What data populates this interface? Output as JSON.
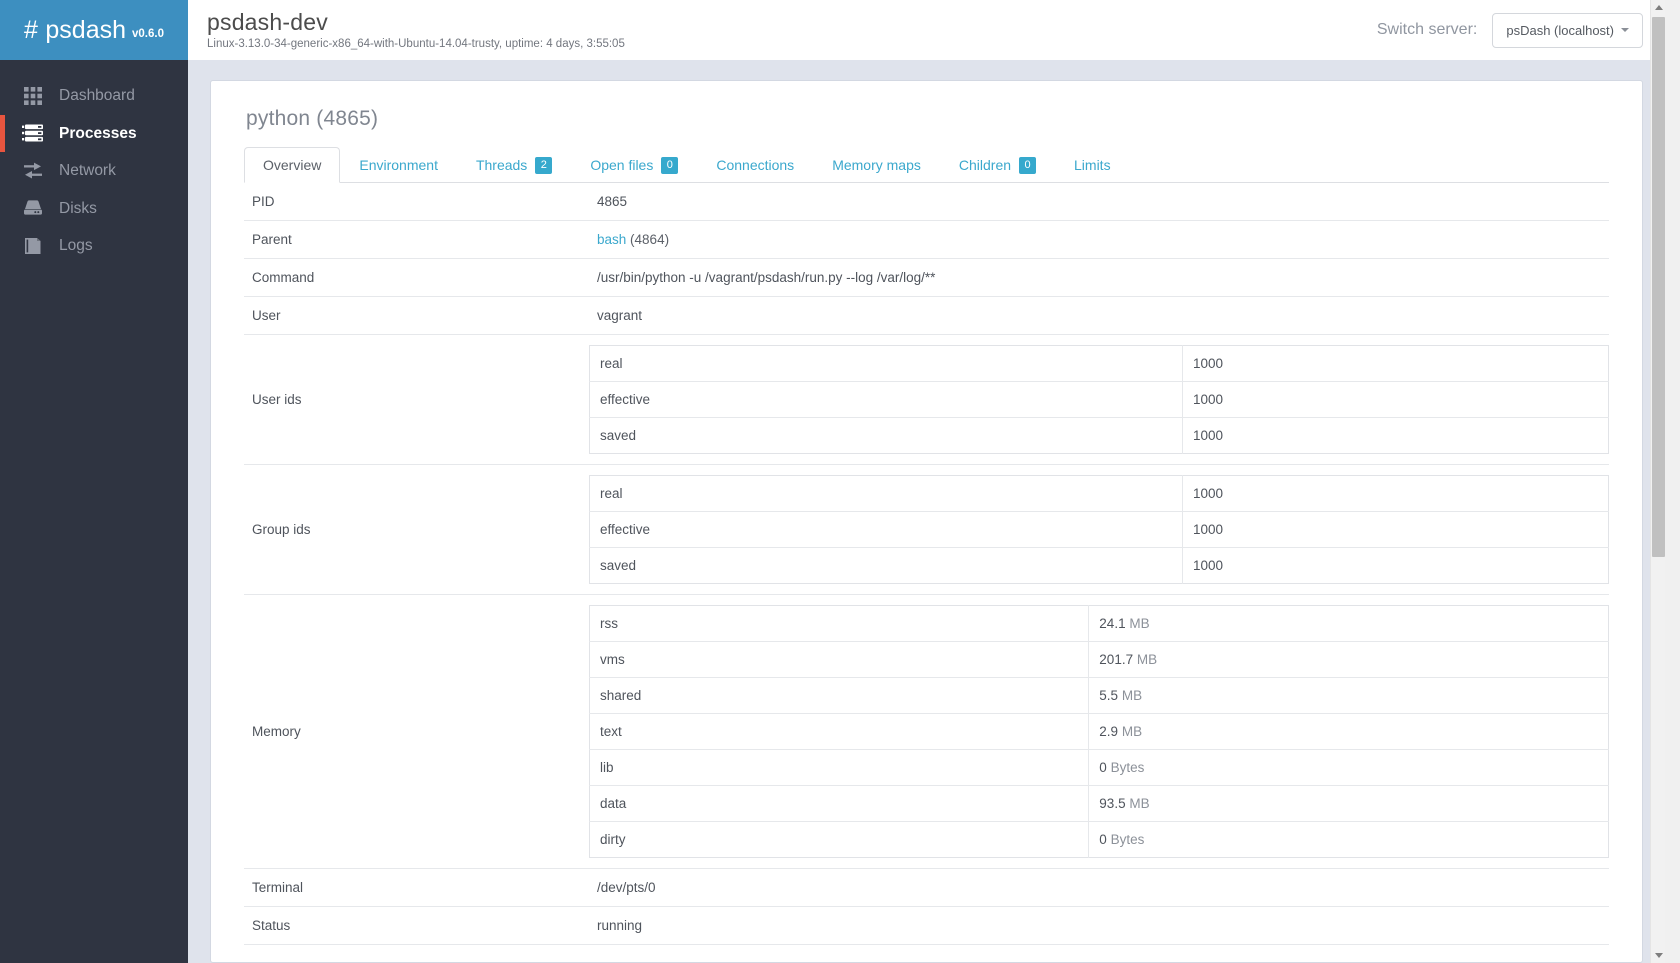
{
  "brand": {
    "hash": "#",
    "name": "psdash",
    "version": "v0.6.0"
  },
  "sidebar": {
    "items": [
      {
        "label": "Dashboard",
        "icon": "grid-icon",
        "active": false
      },
      {
        "label": "Processes",
        "icon": "server-icon",
        "active": true
      },
      {
        "label": "Network",
        "icon": "exchange-icon",
        "active": false
      },
      {
        "label": "Disks",
        "icon": "hdd-icon",
        "active": false
      },
      {
        "label": "Logs",
        "icon": "book-icon",
        "active": false
      }
    ]
  },
  "header": {
    "title": "psdash-dev",
    "subtitle": "Linux-3.13.0-34-generic-x86_64-with-Ubuntu-14.04-trusty, uptime: 4 days, 3:55:05",
    "switch_label": "Switch server:",
    "switch_value": "psDash (localhost)"
  },
  "process": {
    "title": "python (4865)",
    "tabs": [
      {
        "label": "Overview",
        "badge": null,
        "active": true
      },
      {
        "label": "Environment",
        "badge": null,
        "active": false
      },
      {
        "label": "Threads",
        "badge": "2",
        "active": false
      },
      {
        "label": "Open files",
        "badge": "0",
        "active": false
      },
      {
        "label": "Connections",
        "badge": null,
        "active": false
      },
      {
        "label": "Memory maps",
        "badge": null,
        "active": false
      },
      {
        "label": "Children",
        "badge": "0",
        "active": false
      },
      {
        "label": "Limits",
        "badge": null,
        "active": false
      }
    ],
    "rows": {
      "pid_label": "PID",
      "pid_value": "4865",
      "parent_label": "Parent",
      "parent_link": "bash",
      "parent_pid": "(4864)",
      "command_label": "Command",
      "command_value": "/usr/bin/python -u /vagrant/psdash/run.py --log /var/log/**",
      "user_label": "User",
      "user_value": "vagrant",
      "user_ids_label": "User ids",
      "group_ids_label": "Group ids",
      "memory_label": "Memory",
      "terminal_label": "Terminal",
      "terminal_value": "/dev/pts/0",
      "status_label": "Status",
      "status_value": "running"
    },
    "user_ids": [
      {
        "k": "real",
        "v": "1000"
      },
      {
        "k": "effective",
        "v": "1000"
      },
      {
        "k": "saved",
        "v": "1000"
      }
    ],
    "group_ids": [
      {
        "k": "real",
        "v": "1000"
      },
      {
        "k": "effective",
        "v": "1000"
      },
      {
        "k": "saved",
        "v": "1000"
      }
    ],
    "memory": [
      {
        "k": "rss",
        "v": "24.1",
        "u": "MB"
      },
      {
        "k": "vms",
        "v": "201.7",
        "u": "MB"
      },
      {
        "k": "shared",
        "v": "5.5",
        "u": "MB"
      },
      {
        "k": "text",
        "v": "2.9",
        "u": "MB"
      },
      {
        "k": "lib",
        "v": "0",
        "u": "Bytes"
      },
      {
        "k": "data",
        "v": "93.5",
        "u": "MB"
      },
      {
        "k": "dirty",
        "v": "0",
        "u": "Bytes"
      }
    ]
  },
  "colors": {
    "brand_blue": "#3d8fc0",
    "sidebar_dark": "#2f3441",
    "accent_red": "#e8553f",
    "link_blue": "#3ba8cd",
    "badge_blue": "#36a9cd",
    "page_bg": "#dfe3ec"
  }
}
